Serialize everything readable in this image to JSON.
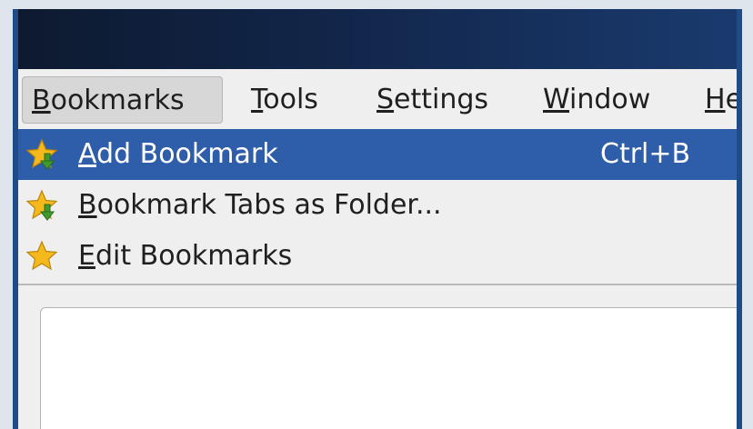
{
  "menubar": {
    "items": [
      {
        "prefix": "",
        "mnemonic": "B",
        "suffix": "ookmarks"
      },
      {
        "prefix": "",
        "mnemonic": "T",
        "suffix": "ools"
      },
      {
        "prefix": "",
        "mnemonic": "S",
        "suffix": "ettings"
      },
      {
        "prefix": "",
        "mnemonic": "W",
        "suffix": "indow"
      },
      {
        "prefix": "",
        "mnemonic": "H",
        "suffix": "e"
      }
    ]
  },
  "dropdown": {
    "items": [
      {
        "mnemonic": "A",
        "rest": "dd Bookmark",
        "shortcut": "Ctrl+B",
        "icon": "bookmark-add-icon"
      },
      {
        "mnemonic": "B",
        "rest": "ookmark Tabs as Folder...",
        "shortcut": "",
        "icon": "bookmark-folder-add-icon"
      },
      {
        "mnemonic": "E",
        "rest": "dit Bookmarks",
        "shortcut": "",
        "icon": "bookmark-star-icon"
      }
    ]
  },
  "colors": {
    "highlight": "#2e5ea9",
    "titlebar": "#12264a",
    "star": "#f6b91d",
    "arrow": "#3f9a2c"
  }
}
